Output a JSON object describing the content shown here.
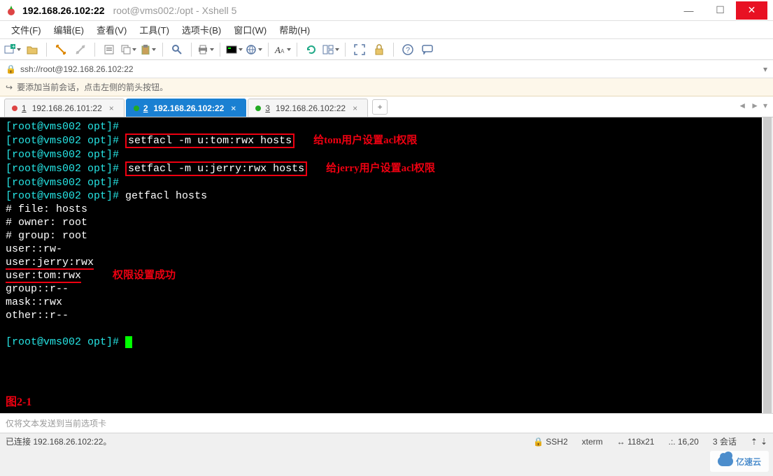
{
  "title": {
    "main": "192.168.26.102:22",
    "sub": "root@vms002:/opt - Xshell 5"
  },
  "menus": [
    "文件(F)",
    "编辑(E)",
    "查看(V)",
    "工具(T)",
    "选项卡(B)",
    "窗口(W)",
    "帮助(H)"
  ],
  "address": "ssh://root@192.168.26.102:22",
  "hint": "要添加当前会话，点击左侧的箭头按钮。",
  "tabs": [
    {
      "num": "1",
      "label": "192.168.26.101:22",
      "active": false,
      "status": "red"
    },
    {
      "num": "2",
      "label": "192.168.26.102:22",
      "active": true,
      "status": "green"
    },
    {
      "num": "3",
      "label": "192.168.26.102:22",
      "active": false,
      "status": "green"
    }
  ],
  "terminal": {
    "prompt": "[root@vms002 opt]#",
    "cmd1": "setfacl -m u:tom:rwx hosts",
    "annot1": "给tom用户设置acl权限",
    "cmd2": "setfacl -m u:jerry:rwx hosts",
    "annot2": "给jerry用户设置acl权限",
    "cmd3": "getfacl hosts",
    "out": [
      "# file: hosts",
      "# owner: root",
      "# group: root",
      "user::rw-"
    ],
    "u_jerry": "user:jerry:rwx",
    "u_tom": "user:tom:rwx",
    "annot3": "权限设置成功",
    "out2": [
      "group::r--",
      "mask::rwx",
      "other::r--"
    ],
    "figlabel": "图2-1"
  },
  "inputbar_placeholder": "仅将文本发送到当前选项卡",
  "status": {
    "conn": "已连接 192.168.26.102:22。",
    "proto": "SSH2",
    "term": "xterm",
    "size": "118x21",
    "pos": "16,20",
    "sessions": "3 会话"
  },
  "watermark": "亿速云",
  "ticon": {
    "up": "⇡",
    "down": "⇣",
    "sizei": "↔"
  }
}
